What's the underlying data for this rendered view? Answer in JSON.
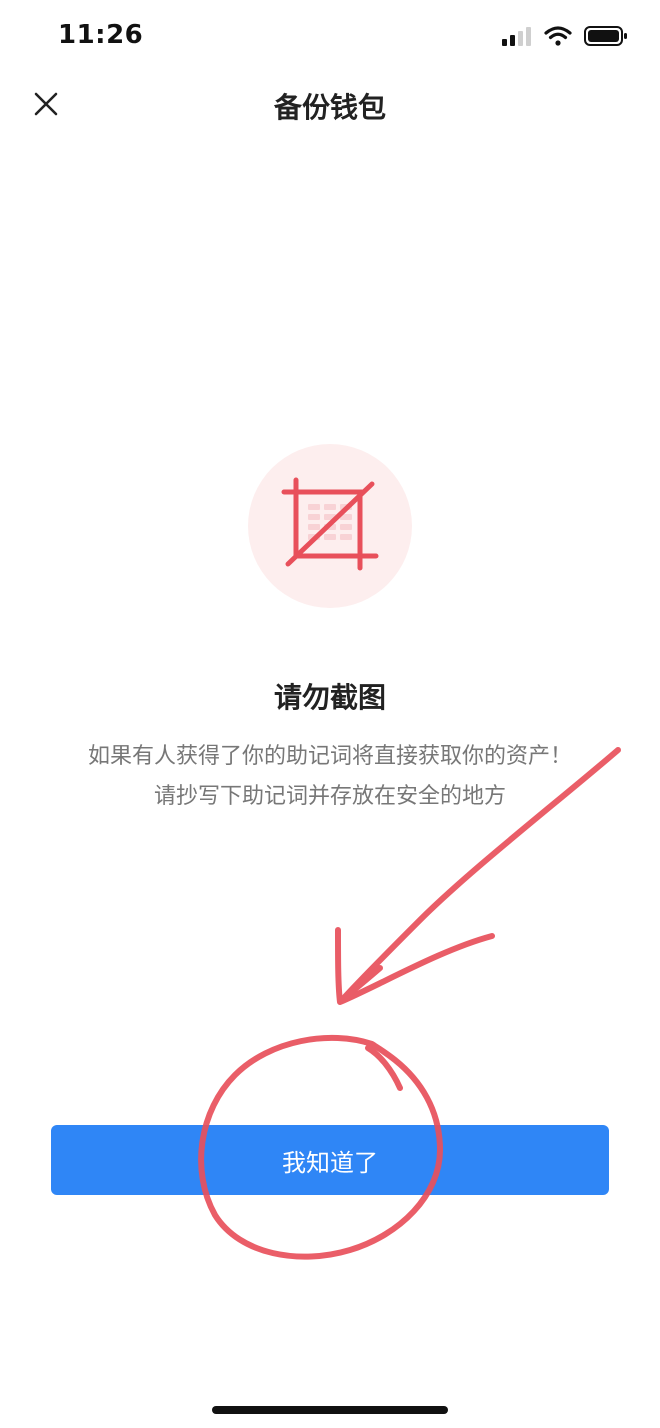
{
  "status_bar": {
    "time": "11:26",
    "icons": [
      "cellular-signal-icon",
      "wifi-icon",
      "battery-icon"
    ]
  },
  "nav": {
    "close_icon": "close-icon",
    "title": "备份钱包"
  },
  "hero": {
    "icon": "no-screenshot-icon",
    "accent_color": "#e8505b",
    "circle_color": "#fdeeee"
  },
  "warning": {
    "title": "请勿截图",
    "line1": "如果有人获得了你的助记词将直接获取你的资产！",
    "line2": "请抄写下助记词并存放在安全的地方"
  },
  "actions": {
    "confirm_label": "我知道了",
    "confirm_color": "#2f86f6"
  },
  "annotation": {
    "color": "#e8505b",
    "shapes": [
      "hand-drawn-arrow",
      "hand-drawn-circle"
    ]
  }
}
